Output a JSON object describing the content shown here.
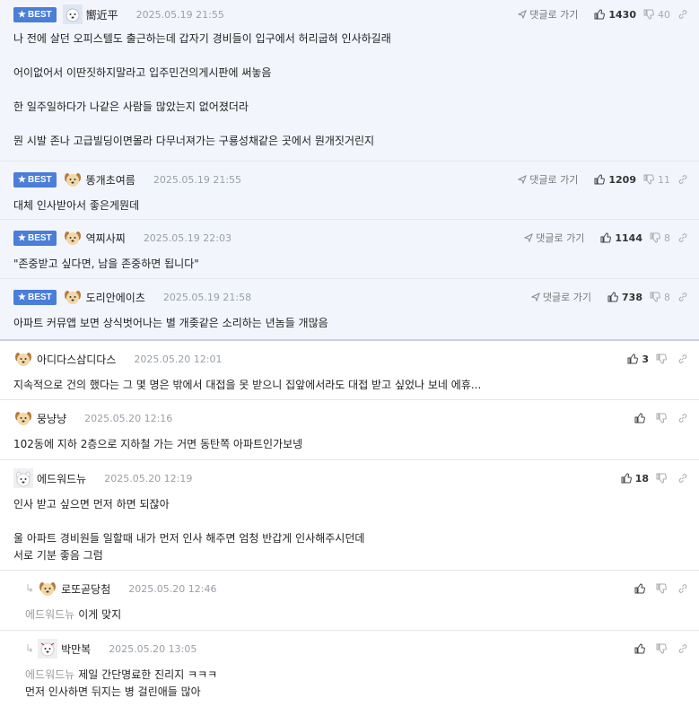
{
  "reply_label": "댓글로 가기",
  "best_label": "BEST",
  "comments": [
    {
      "nick": "嚮近平",
      "date": "2025.05.19 21:55",
      "up": "1430",
      "down": "40",
      "lines": [
        "나 전에 살던 오피스텔도 출근하는데 갑자기 경비들이 입구에서 허리굽혀 인사하길래",
        "",
        "어이없어서 이딴짓하지말라고 입주민건의게시판에 써놓음",
        "",
        "한 일주일하다가 나같은 사람들 많았는지 없어졌더라",
        "",
        "뭔 시발 존나 고급빌딩이면몰라 다무너져가는 구룡성채같은 곳에서 뭔개짓거린지"
      ]
    },
    {
      "nick": "똥개초여름",
      "date": "2025.05.19 21:55",
      "up": "1209",
      "down": "11",
      "lines": [
        "대체 인사받아서 좋은게뭔데"
      ]
    },
    {
      "nick": "역찌사찌",
      "date": "2025.05.19 22:03",
      "up": "1144",
      "down": "8",
      "lines": [
        "\"존중받고 싶다면, 남을 존중하면 됩니다\""
      ]
    },
    {
      "nick": "도리안에이츠",
      "date": "2025.05.19 21:58",
      "up": "738",
      "down": "8",
      "lines": [
        "아파트 커뮤앱 보면 상식벗어나는 별 개좆같은 소리하는 년놈들 개많음"
      ]
    },
    {
      "nick": "아디다스삼디다스",
      "date": "2025.05.20 12:01",
      "up": "3",
      "down": "",
      "lines": [
        "지속적으로 건의 했다는 그 몇 명은 밖에서 대접을 못 받으니 집앞에서라도 대접 받고 싶었나 보네 에휴..."
      ]
    },
    {
      "nick": "뭉냥냥",
      "date": "2025.05.20 12:16",
      "up": "",
      "down": "",
      "lines": [
        "102동에 지하 2층으로 지하철 가는 거면 동탄쪽 아파트인가보넹"
      ]
    },
    {
      "nick": "에드워드뉴",
      "date": "2025.05.20 12:19",
      "up": "18",
      "down": "",
      "lines": [
        "인사 받고 싶으면 먼저 하면 되잖아",
        "",
        "울 아파트 경비원들 일할때 내가 먼저 인사 해주면 엄청 반갑게 인사해주시던데",
        "서로 기분 좋음 그럼"
      ]
    },
    {
      "nick": "로또곧당첨",
      "date": "2025.05.20 12:46",
      "up": "",
      "down": "",
      "mention": "에드워드뉴",
      "lines": [
        "이게 맞지"
      ]
    },
    {
      "nick": "박만복",
      "date": "2025.05.20 13:05",
      "up": "",
      "down": "",
      "mention": "에드워드뉴",
      "lines": [
        "제일 간단명료한 진리지 ㅋㅋㅋ",
        "먼저 인사하면 뒤지는 병 걸린애들 많아"
      ]
    }
  ]
}
